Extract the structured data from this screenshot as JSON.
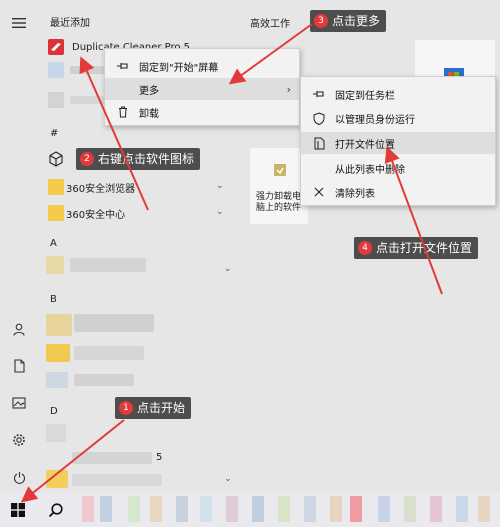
{
  "start_menu": {
    "recent_section": "最近添加",
    "recent_app_name": "Duplicate Cleaner Pro 5",
    "hash_section": "#",
    "section_a": "A",
    "section_b": "B",
    "section_d": "D",
    "folder_items": [
      "360安全浏览器",
      "360安全中心"
    ],
    "fragment_5": "5"
  },
  "tiles": {
    "group_title": "高效工作",
    "tile_label": "强力卸载电脑上的软件"
  },
  "context_menu": {
    "items": [
      "固定到\"开始\"屏幕",
      "更多",
      "卸载"
    ],
    "submenu": [
      "固定到任务栏",
      "以管理员身份运行",
      "打开文件位置",
      "从此列表中删除",
      "清除列表"
    ]
  },
  "callouts": [
    {
      "num": "1",
      "text": "点击开始"
    },
    {
      "num": "2",
      "text": "右键点击软件图标"
    },
    {
      "num": "3",
      "text": "点击更多"
    },
    {
      "num": "4",
      "text": "点击打开文件位置"
    }
  ],
  "colors": {
    "arrow": "#e23a3a",
    "callout_bg": "#4d4d4d",
    "folder": "#f5c94a",
    "menu_bg": "#f2f2f2"
  },
  "icons": [
    "menu-icon",
    "user-icon",
    "document-icon",
    "pictures-icon",
    "settings-icon",
    "power-icon",
    "windows-logo-icon",
    "search-icon",
    "pin-icon",
    "trash-icon",
    "shield-icon",
    "folder-open-icon",
    "close-icon",
    "cube-icon"
  ]
}
